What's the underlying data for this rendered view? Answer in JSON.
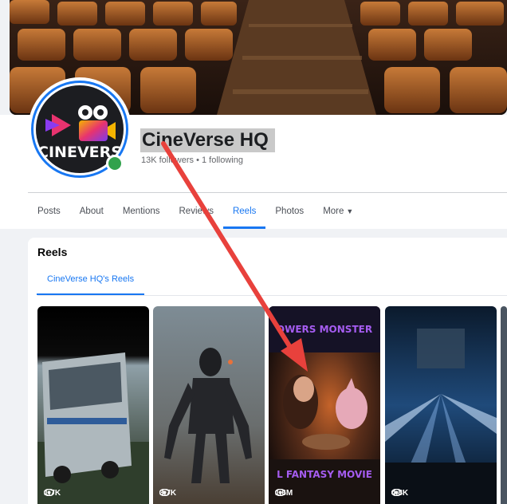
{
  "profile": {
    "name": "CineVerse HQ",
    "stats": "13K followers • 1 following",
    "avatar_text": "CINEVERS"
  },
  "tabs": [
    {
      "label": "Posts"
    },
    {
      "label": "About"
    },
    {
      "label": "Mentions"
    },
    {
      "label": "Reviews"
    },
    {
      "label": "Reels"
    },
    {
      "label": "Photos"
    },
    {
      "label": "More"
    }
  ],
  "active_tab": "Reels",
  "reels": {
    "title": "Reels",
    "subtab": "CineVerse HQ's Reels",
    "items": [
      {
        "views": "1.7K",
        "top_caption": "",
        "bottom_caption": ""
      },
      {
        "views": "3.7K",
        "top_caption": "",
        "bottom_caption": ""
      },
      {
        "views": "1.6M",
        "top_caption": "OWERS MONSTER",
        "bottom_caption": "L FANTASY MOVIE"
      },
      {
        "views": "4.8K",
        "top_caption": "",
        "bottom_caption": ""
      }
    ]
  },
  "colors": {
    "accent": "#1877f2",
    "online": "#31a24c",
    "annotation": "#e8413c"
  },
  "icons": {
    "views": "eye-icon",
    "more": "caret-down-icon"
  }
}
